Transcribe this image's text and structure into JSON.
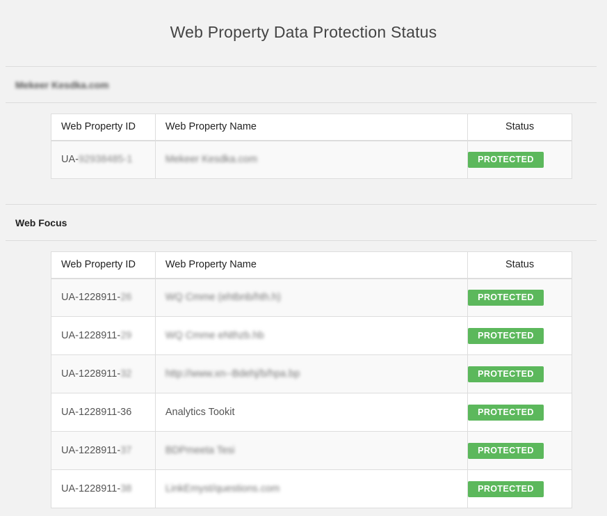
{
  "page_title": "Web Property Data Protection Status",
  "table_headers": {
    "id": "Web Property ID",
    "name": "Web Property Name",
    "status": "Status"
  },
  "accounts": [
    {
      "name": "Mekeer Kesdka.com",
      "name_redacted": true,
      "properties": [
        {
          "id_prefix": "UA-",
          "id_suffix": "92938485-1",
          "name": "Mekeer Kesdka.com",
          "name_redacted": true,
          "status": "PROTECTED"
        }
      ]
    },
    {
      "name": "Web Focus",
      "name_redacted": false,
      "properties": [
        {
          "id_prefix": "UA-1228911-",
          "id_suffix": "26",
          "name": "WQ Cmme (ehtbnb/hth.h)",
          "name_redacted": true,
          "status": "PROTECTED"
        },
        {
          "id_prefix": "UA-1228911-",
          "id_suffix": "29",
          "name": "WQ Cmme eNthzb.hb",
          "name_redacted": true,
          "status": "PROTECTED"
        },
        {
          "id_prefix": "UA-1228911-",
          "id_suffix": "32",
          "name": "http://www.xn--Bdehj/b/hpa.bp",
          "name_redacted": true,
          "status": "PROTECTED"
        },
        {
          "id_prefix": "UA-1228911-36",
          "id_suffix": "",
          "name": "Analytics Tookit",
          "name_redacted": false,
          "status": "PROTECTED"
        },
        {
          "id_prefix": "UA-1228911-",
          "id_suffix": "37",
          "name": "BDPmeeta Tesi",
          "name_redacted": true,
          "status": "PROTECTED"
        },
        {
          "id_prefix": "UA-1228911-",
          "id_suffix": "38",
          "name": "LinkEmyst/questions.com",
          "name_redacted": true,
          "status": "PROTECTED"
        }
      ]
    }
  ],
  "colors": {
    "background": "#f2f2f2",
    "badge": "#5cb85c",
    "badge_text": "#ffffff",
    "row_stripe": "#f9f9f9"
  }
}
